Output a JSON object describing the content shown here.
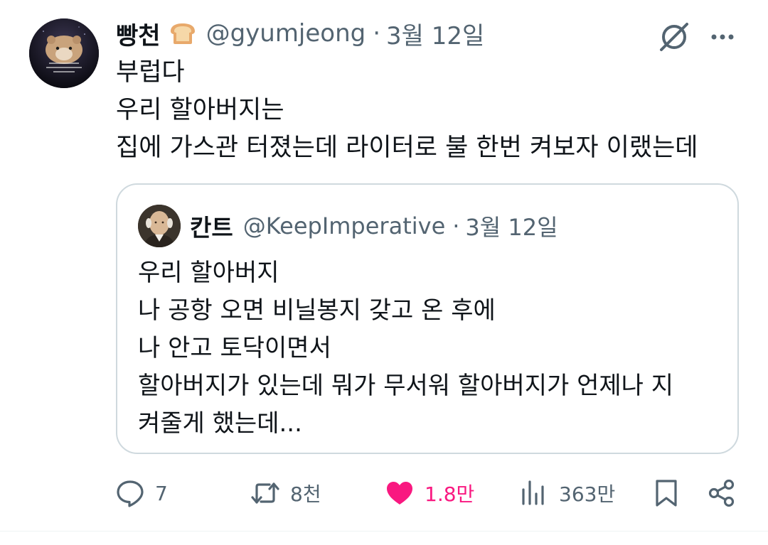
{
  "tweet": {
    "author_name": "빵천",
    "author_handle": "@gyumjeong",
    "separator": "·",
    "date": "3월 12일",
    "lines": [
      "부럽다",
      "우리 할아버지는",
      "집에 가스관 터졌는데 라이터로 불 한번 켜보자 이랬는데"
    ],
    "avatar_icon": "hamster-avatar",
    "badge_icon": "bread-icon"
  },
  "quote": {
    "author_name": "칸트",
    "author_handle": "@KeepImperative",
    "separator": "·",
    "date": "3월 12일",
    "lines": [
      "우리 할아버지",
      "나 공항 오면 비닐봉지 갖고 온 후에",
      "나 안고 토닥이면서",
      "할아버지가 있는데 뭐가 무서워 할아버지가 언제나 지",
      "켜줄게 했는데..."
    ],
    "avatar_icon": "kant-portrait-avatar"
  },
  "actions": {
    "replies": "7",
    "retweets": "8천",
    "likes": "1.8만",
    "views": "363만"
  },
  "colors": {
    "text": "#0f1419",
    "secondary": "#536471",
    "like": "#f91880",
    "border": "#cfd9de"
  }
}
